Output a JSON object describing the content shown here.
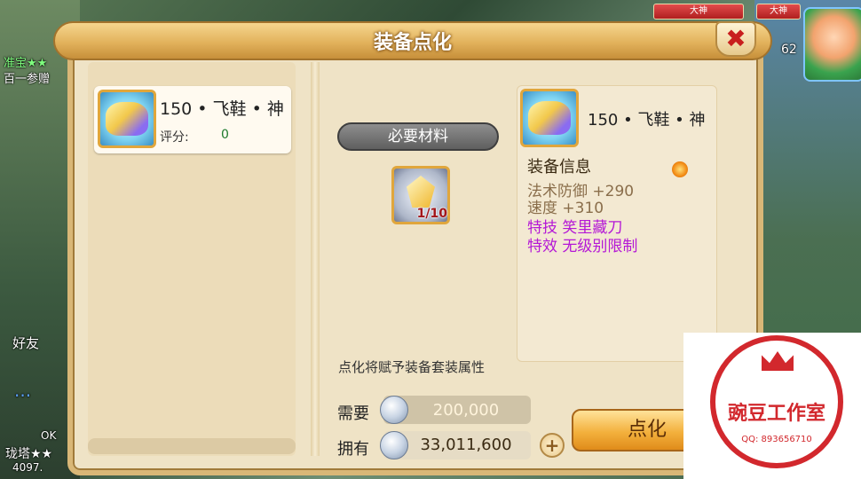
{
  "hud": {
    "top_left_text": "准宝★★",
    "top_left_sub": "百一参赠",
    "friends_label": "好友",
    "chat_label": "...",
    "bottom_left_line1": "OK",
    "bottom_left_line2": "珑塔★★",
    "bottom_left_line3": "4097.",
    "hp_label_1": "大神",
    "hp_label_2": "大神",
    "right_num": "62"
  },
  "dialog": {
    "title": "装备点化",
    "close_label": "✖"
  },
  "left_panel": {
    "item_name": "150 • 飞鞋 • 神",
    "score_label": "评分:",
    "score_value": "0"
  },
  "materials": {
    "banner": "必要材料",
    "count": "1/10"
  },
  "info": {
    "item_name": "150 • 飞鞋 • 神",
    "title": "装备信息",
    "attrs": [
      {
        "text": "法术防御  +290",
        "kind": "base"
      },
      {
        "text": "速度  +310",
        "kind": "base"
      },
      {
        "text": "特技  笑里藏刀",
        "kind": "special"
      },
      {
        "text": "特效  无级别限制",
        "kind": "special"
      }
    ]
  },
  "bottom": {
    "description": "点化将赋予装备套装属性",
    "need_label": "需要",
    "need_value": "200,000",
    "own_label": "拥有",
    "own_value": "33,011,600",
    "plus_label": "+",
    "action_label": "点化"
  },
  "watermark": {
    "name": "豌豆工作室",
    "qq": "QQ: 893656710"
  },
  "colors": {
    "accent_gold": "#e0a63c",
    "special_purple": "#b418d6",
    "close_red": "#c81e1e",
    "watermark_red": "#d2282d"
  }
}
